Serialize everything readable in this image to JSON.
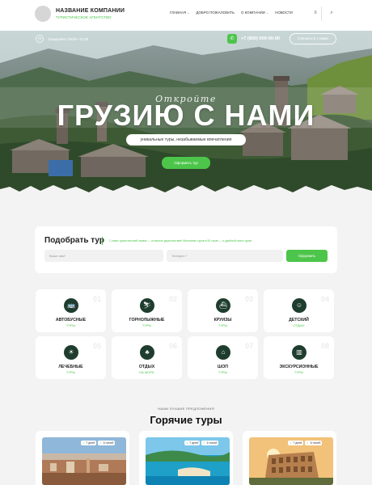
{
  "header": {
    "company_name": "НАЗВАНИЕ КОМПАНИИ",
    "tagline": "ТУРИСТИЧЕСКОЕ АГЕНТСТВО",
    "nav": [
      {
        "label": "ГЛАВНАЯ",
        "has_dropdown": true
      },
      {
        "label": "ДОБРО ПОЖАЛОВАТЬ",
        "has_dropdown": false
      },
      {
        "label": "О КОМПАНИИ",
        "has_dropdown": true
      },
      {
        "label": "НОВОСТИ",
        "has_dropdown": false
      }
    ]
  },
  "topbar": {
    "address": "Ежедневно: 09:00—21:00",
    "phone": "+7 (800) 000-00-00",
    "contact_button": "Связаться с нами"
  },
  "hero": {
    "subtitle": "Откройте",
    "title": "ГРУЗИЮ С НАМИ",
    "pill": "уникальные туры, незабываемые впечатления",
    "button": "Оформить тур"
  },
  "search": {
    "title": "Подобрать тур",
    "note": "С нами туристический сервис — отличное удовольствие! Миллионы туров в 90 стран — и удобный поиск туров",
    "field1_placeholder": "Ваше имя*",
    "field2_placeholder": "Телефон *",
    "button": "Оформить"
  },
  "categories": [
    {
      "title": "АВТОБУСНЫЕ",
      "sub": "ТУРЫ",
      "num": "01",
      "icon": "bus-icon",
      "glyph": "🚌"
    },
    {
      "title": "ГОРНОЛЫЖНЫЕ",
      "sub": "ТУРЫ",
      "num": "02",
      "icon": "skier-icon",
      "glyph": "⛷"
    },
    {
      "title": "КРУИЗЫ",
      "sub": "ТУРЫ",
      "num": "03",
      "icon": "ship-icon",
      "glyph": "⛴"
    },
    {
      "title": "ДЕТСКИЙ",
      "sub": "ОТДЫХ",
      "num": "04",
      "icon": "kids-icon",
      "glyph": "☺"
    },
    {
      "title": "ЛЕЧЕБНЫЕ",
      "sub": "ТУРЫ",
      "num": "05",
      "icon": "sun-icon",
      "glyph": "☀"
    },
    {
      "title": "ОТДЫХ",
      "sub": "НА МОРЕ",
      "num": "06",
      "icon": "palm-icon",
      "glyph": "♣"
    },
    {
      "title": "ШОП",
      "sub": "ТУРЫ",
      "num": "07",
      "icon": "shopping-icon",
      "glyph": "⌂"
    },
    {
      "title": "ЭКСКУРСИОННЫЕ",
      "sub": "ТУРЫ",
      "num": "08",
      "icon": "luggage-icon",
      "glyph": "▥"
    }
  ],
  "hot_tours": {
    "kicker": "НАШИ ЛУЧШИЕ ПРЕДЛОЖЕНИЯ",
    "title": "Горячие туры",
    "tours": [
      {
        "days": "7 дней",
        "nights": "6 ночей"
      },
      {
        "days": "7 дней",
        "nights": "6 ночей"
      },
      {
        "days": "7 дней",
        "nights": "6 ночей"
      }
    ]
  },
  "colors": {
    "accent": "#4cc54a",
    "icon_bg": "#1e3d2e",
    "page_bg": "#f3f3f3"
  }
}
